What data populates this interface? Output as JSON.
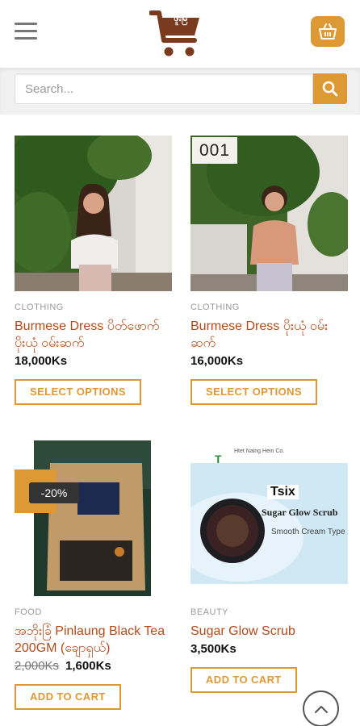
{
  "header": {
    "logo_text": "ဖူးမြ",
    "menu_icon": "hamburger-menu-icon",
    "cart_icon": "basket-icon"
  },
  "search": {
    "placeholder": "Search...",
    "button_icon": "search-icon"
  },
  "products": [
    {
      "category": "CLOTHING",
      "title": "Burmese Dress ပိတ်ဖောက် ပိုးယုံ ဝမ်းဆက်",
      "price": "18,000Ks",
      "button": "SELECT OPTIONS"
    },
    {
      "ribbon": "001",
      "category": "CLOTHING",
      "title": "Burmese Dress ပိုးယုံ ဝမ်း ဆက်",
      "price": "16,000Ks",
      "button": "SELECT OPTIONS"
    },
    {
      "sale_badge": "-20%",
      "category": "FOOD",
      "title": "အဘိုးခြံ Pinlaung Black Tea 200GM (ချောရှယ်)",
      "old_price": "2,000Ks",
      "price": "1,600Ks",
      "button": "ADD TO CART"
    },
    {
      "brand": "Tsix",
      "brand_company": "Htet Naing Hein Co.",
      "product_line": "Sugar Glow Scrub",
      "product_sub": "Smooth Cream Type",
      "category": "BEAUTY",
      "title": "Sugar Glow Scrub",
      "price": "3,500Ks",
      "button": "ADD TO CART"
    }
  ],
  "colors": {
    "accent": "#dd9933",
    "title_link": "#b04a1a",
    "logo": "#7a3a1e"
  }
}
